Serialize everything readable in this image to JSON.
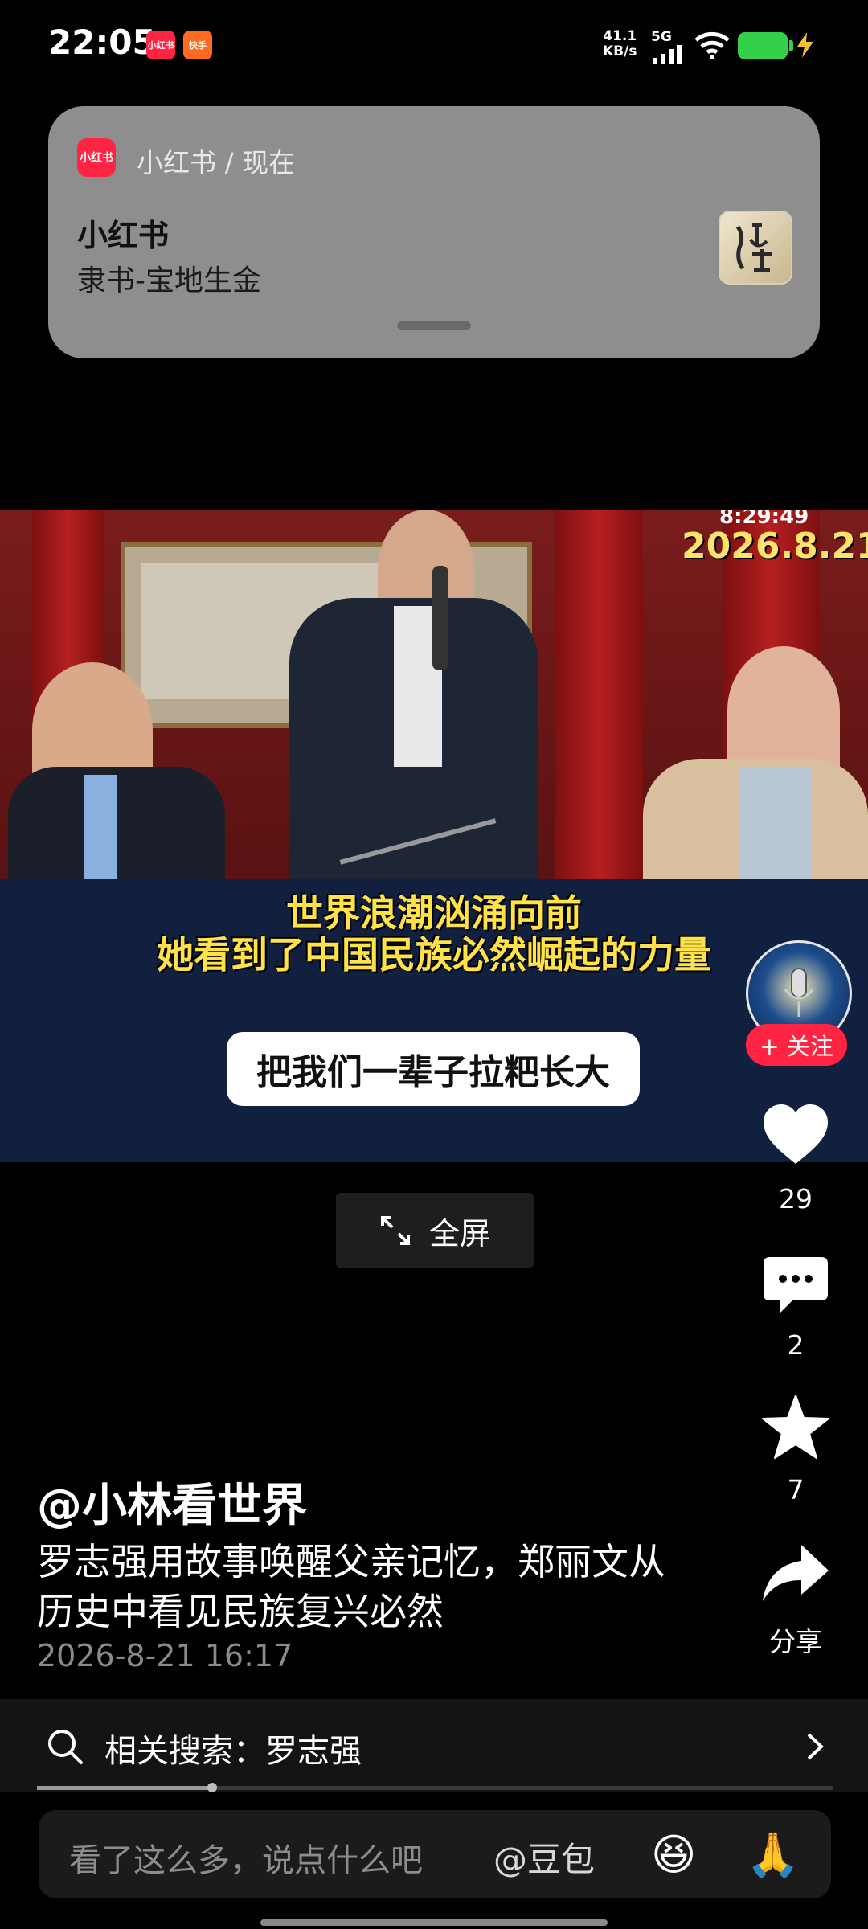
{
  "status_bar": {
    "time": "22:05",
    "app_icons": [
      "小红书",
      "快手"
    ],
    "net_speed_value": "41.1",
    "net_speed_unit": "KB/s",
    "network": "5G",
    "battery_color": "#33d14a"
  },
  "notification": {
    "app_icon_label": "小红书",
    "source": "小红书 / 现在",
    "title": "小红书",
    "body": "隶书-宝地生金"
  },
  "video": {
    "timestamp": "8:29:49",
    "date_overlay": "2026.8.21",
    "caption_line1": "世界浪潮汹涌向前",
    "caption_line2": "她看到了中国民族必然崛起的力量",
    "sticker_text": "把我们一辈子拉粑长大"
  },
  "fullscreen": {
    "label": "全屏",
    "icon": "expand-icon"
  },
  "right_rail": {
    "follow_label": "+ 关注",
    "likes": "29",
    "comments": "2",
    "favorites": "7",
    "share_label": "分享"
  },
  "post": {
    "author": "@小林看世界",
    "title": "罗志强用故事唤醒父亲记忆，郑丽文从历史中看见民族复兴必然",
    "time": "2026-8-21 16:17"
  },
  "related_search": {
    "label": "相关搜索：罗志强"
  },
  "playback": {
    "progress_fraction": 0.22
  },
  "comment_bar": {
    "placeholder": "看了这么多，说点什么吧",
    "mention": "@豆包",
    "emoji_1": "😆",
    "emoji_2": "🙏"
  },
  "colors": {
    "accent": "#ff2442",
    "caption_yellow": "#ffe14a"
  }
}
